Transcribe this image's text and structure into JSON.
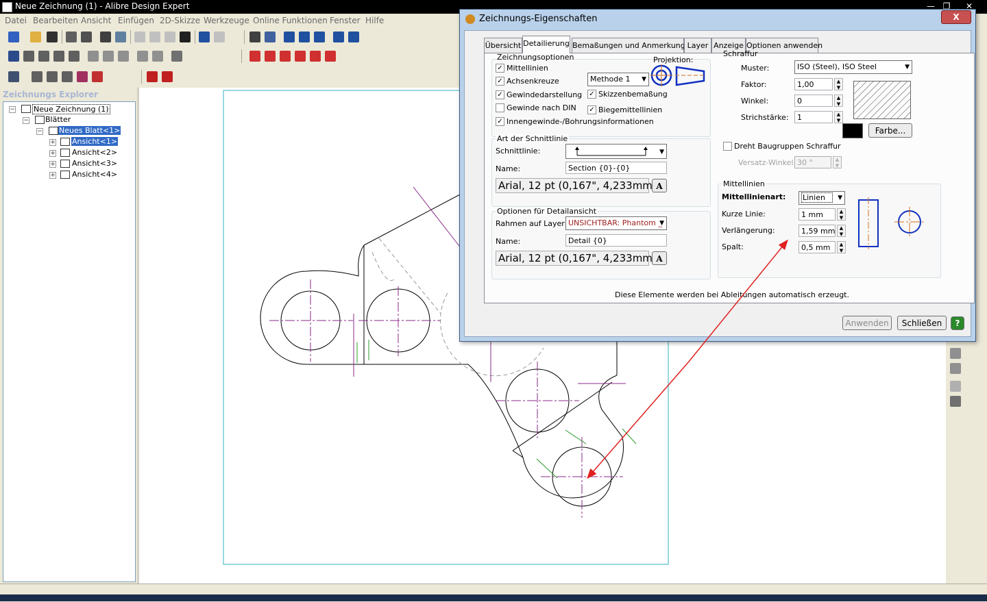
{
  "window": {
    "title": "Neue Zeichnung (1) - Alibre Design Expert"
  },
  "menu": [
    "Datei",
    "Bearbeiten",
    "Ansicht",
    "Einfügen",
    "2D-Skizze",
    "Werkzeuge",
    "Online Funktionen",
    "Fenster",
    "Hilfe"
  ],
  "explorer": {
    "title": "Zeichnungs Explorer",
    "tree": [
      {
        "label": "Neue Zeichnung (1)",
        "level": 0,
        "expand": "−"
      },
      {
        "label": "Blätter",
        "level": 1,
        "expand": "−"
      },
      {
        "label": "Neues Blatt<1>",
        "level": 2,
        "expand": "−",
        "selected": true
      },
      {
        "label": "Ansicht<1>",
        "level": 3,
        "expand": "+",
        "selected": true
      },
      {
        "label": "Ansicht<2>",
        "level": 3,
        "expand": "+"
      },
      {
        "label": "Ansicht<3>",
        "level": 3,
        "expand": "+"
      },
      {
        "label": "Ansicht<4>",
        "level": 3,
        "expand": "+"
      }
    ]
  },
  "dialog": {
    "title": "Zeichnungs-Eigenschaften",
    "close": "X",
    "tabs": [
      "Übersicht",
      "Detailierung",
      "Bemaßungen und Anmerkungen",
      "Layer",
      "Anzeige",
      "Optionen anwenden"
    ],
    "active_tab": "Detailierung",
    "zeichnungsoptionen": {
      "title": "Zeichnungsoptionen",
      "projektion_label": "Projektion:",
      "methode": "Methode 1",
      "options": [
        {
          "label": "Mittellinien",
          "checked": true
        },
        {
          "label": "Achsenkreuze",
          "checked": true
        },
        {
          "label": "Gewindedarstellung",
          "checked": true
        },
        {
          "label": "Gewinde nach DIN",
          "checked": false
        },
        {
          "label": "Innengewinde-/Bohrungsinformationen",
          "checked": true
        },
        {
          "label": "Skizzenbemaßung",
          "checked": true
        },
        {
          "label": "Biegemittellinien",
          "checked": true
        }
      ]
    },
    "schnittlinie": {
      "title": "Art der Schnittlinie",
      "schnittlinie_label": "Schnittlinie:",
      "name_label": "Name:",
      "name_value": "Section {0}-{0}",
      "font": "Arial, 12 pt (0,167\", 4,233mm)",
      "font_button": "A"
    },
    "detailansicht": {
      "title": "Optionen für Detailansicht",
      "rahmen_label": "Rahmen auf Layer:",
      "rahmen_value": "UNSICHTBAR: Phantom _",
      "name_label": "Name:",
      "name_value": "Detail {0}",
      "font": "Arial, 12 pt (0,167\", 4,233mm)",
      "font_button": "A"
    },
    "schraffur": {
      "title": "Schraffur",
      "muster_label": "Muster:",
      "muster_value": "ISO (Steel), ISO Steel",
      "faktor_label": "Faktor:",
      "faktor_value": "1,00",
      "winkel_label": "Winkel:",
      "winkel_value": "0",
      "strich_label": "Strichstärke:",
      "strich_value": "1",
      "farbe_button": "Farbe...",
      "color": "#000000",
      "dreht_label": "Dreht Baugruppen Schraffur",
      "dreht_checked": false,
      "versatz_label": "Versatz-Winkel:",
      "versatz_value": "30 °"
    },
    "mittellinien": {
      "title": "Mittellinien",
      "art_label": "Mittellinienart:",
      "art_value": "Linien",
      "kurze_label": "Kurze Linie:",
      "kurze_value": "1 mm",
      "verl_label": "Verlängerung:",
      "verl_value": "1,59 mm",
      "spalt_label": "Spalt:",
      "spalt_value": "0,5 mm"
    },
    "footer_note": "Diese Elemente werden bei Ableitungen automatisch erzeugt.",
    "buttons": {
      "apply": "Anwenden",
      "close": "Schließen",
      "help": "?"
    }
  },
  "colors": {
    "centerline": "#8a2a8a",
    "arrow": "#e02020",
    "selection": "#316ac5"
  }
}
